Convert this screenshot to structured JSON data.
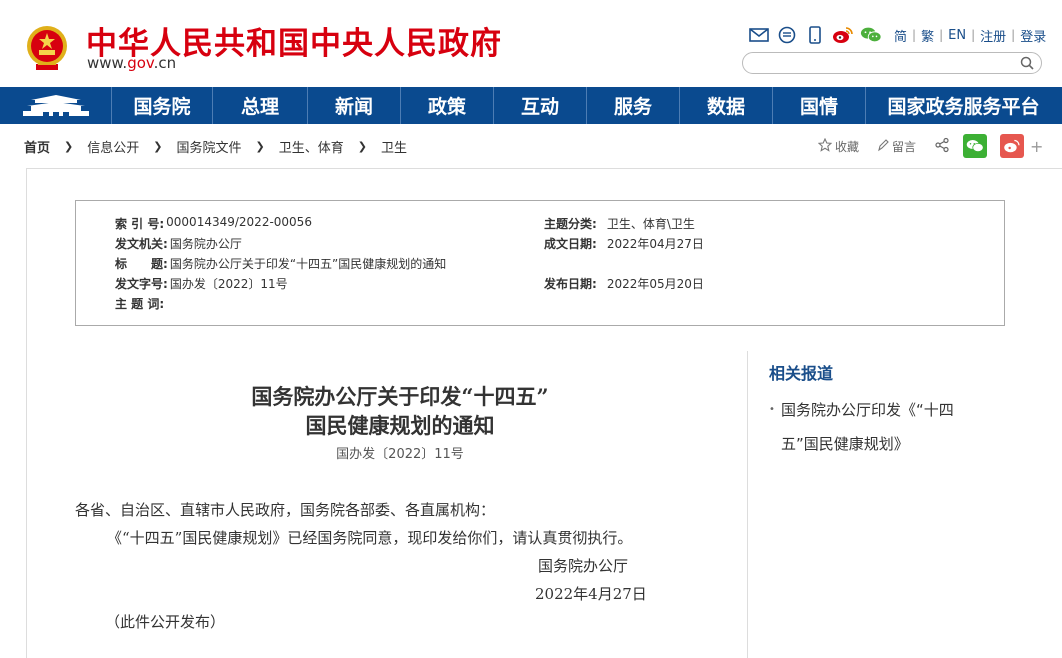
{
  "header": {
    "site_title": "中华人民共和国中央人民政府",
    "site_url_prefix": "www.",
    "site_url_gov": "gov",
    "site_url_suffix": ".cn",
    "tool_icons": [
      "mail-icon",
      "message-icon",
      "mobile-icon",
      "weibo-icon",
      "wechat-icon"
    ],
    "lang_links": [
      "简",
      "繁",
      "EN",
      "注册",
      "登录"
    ],
    "search_placeholder": ""
  },
  "nav": {
    "items": [
      "国务院",
      "总理",
      "新闻",
      "政策",
      "互动",
      "服务",
      "数据",
      "国情",
      "国家政务服务平台"
    ]
  },
  "breadcrumb": {
    "items": [
      "首页",
      "信息公开",
      "国务院文件",
      "卫生、体育",
      "卫生"
    ]
  },
  "share": {
    "favorite": "收藏",
    "comment": "留言"
  },
  "info": {
    "index_label": "索 引 号:",
    "index_value": "000014349/2022-00056",
    "issuer_label": "发文机关:",
    "issuer_value": "国务院办公厅",
    "title_label": "标　　题:",
    "title_value": "国务院办公厅关于印发“十四五”国民健康规划的通知",
    "docno_label": "发文字号:",
    "docno_value": "国办发〔2022〕11号",
    "keywords_label": "主 题 词:",
    "keywords_value": "",
    "category_label": "主题分类:",
    "category_value": "卫生、体育\\卫生",
    "created_label": "成文日期:",
    "created_value": "2022年04月27日",
    "published_label": "发布日期:",
    "published_value": "2022年05月20日"
  },
  "related": {
    "title": "相关报道",
    "items": [
      {
        "line1": "国务院办公厅印发《“十四",
        "line2": "五”国民健康规划》"
      }
    ]
  },
  "document": {
    "title_line1": "国务院办公厅关于印发“十四五”",
    "title_line2": "国民健康规划的通知",
    "number": "国办发〔2022〕11号",
    "salutation": "各省、自治区、直辖市人民政府，国务院各部委、各直属机构：",
    "body": "《“十四五”国民健康规划》已经国务院同意，现印发给你们，请认真贯彻执行。",
    "signature": "国务院办公厅",
    "date": "2022年4月27日",
    "note": "（此件公开发布）"
  },
  "colors": {
    "brand_red": "#d7000f",
    "nav_blue": "#0a4a8f",
    "link_blue": "#1a4e8a"
  }
}
